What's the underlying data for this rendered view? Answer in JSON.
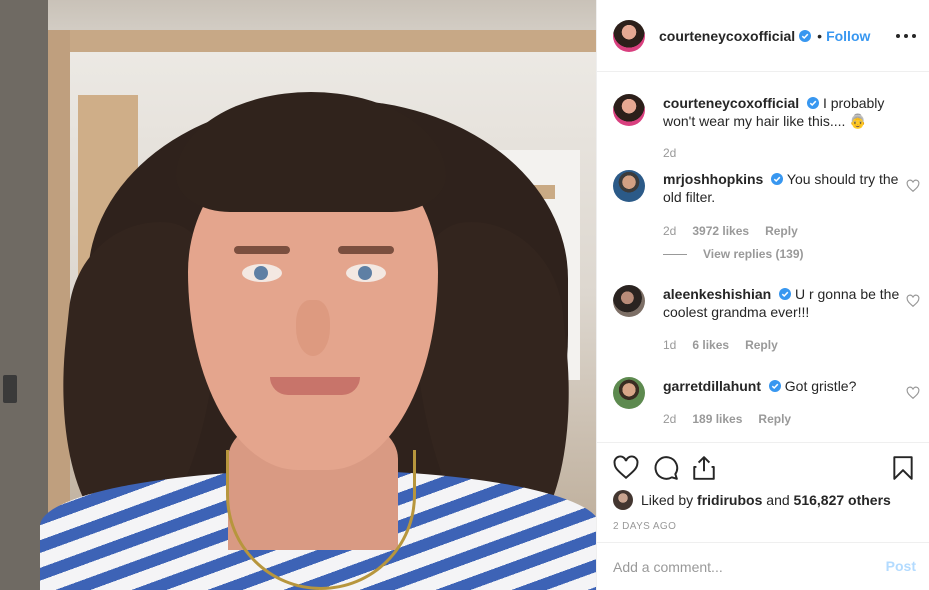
{
  "post": {
    "username": "courteneycoxofficial",
    "dot": "•",
    "follow_label": "Follow",
    "caption_user": "courteneycoxofficial",
    "caption_text": "I probably won't wear my hair like this.... 👵",
    "caption_time": "2d"
  },
  "comments": [
    {
      "user": "mrjoshhopkins",
      "text": "You should try the old filter.",
      "time": "2d",
      "likes": "3972 likes",
      "reply": "Reply",
      "view_replies": "View replies (139)"
    },
    {
      "user": "aleenkeshishian",
      "text": "U r gonna be the coolest grandma ever!!!",
      "time": "1d",
      "likes": "6 likes",
      "reply": "Reply"
    },
    {
      "user": "garretdillahunt",
      "text": "Got gristle?",
      "time": "2d",
      "likes": "189 likes",
      "reply": "Reply"
    }
  ],
  "likes": {
    "prefix": "Liked by",
    "user": "fridirubos",
    "and": "and",
    "count": "516,827 others"
  },
  "date": "2 DAYS AGO",
  "comment_box": {
    "placeholder": "Add a comment...",
    "post_label": "Post"
  },
  "icons": [
    "heart-icon",
    "comment-icon",
    "share-icon",
    "bookmark-icon",
    "more-icon",
    "verified-icon"
  ],
  "colors": {
    "link": "#3897f0",
    "muted": "#999999",
    "post_disabled": "#b3dbff",
    "text": "#262626"
  }
}
